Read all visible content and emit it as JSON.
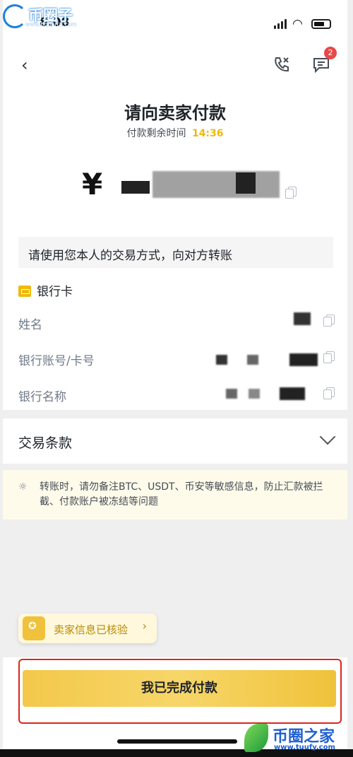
{
  "watermark_top": {
    "brand": "币圈子",
    "url": "www.bquanzi.com"
  },
  "status_bar": {
    "time": "8:08"
  },
  "header": {
    "back_glyph": "‹",
    "chat_badge": "2",
    "title": "请向卖家付款",
    "timer_label": "付款剩余时间",
    "timer_value": "14:36"
  },
  "payment": {
    "currency_symbol": "¥",
    "notice": "请使用您本人的交易方式，向对方转账",
    "method": "银行卡",
    "fields": [
      {
        "label": "姓名"
      },
      {
        "label": "银行账号/卡号"
      },
      {
        "label": "银行名称"
      }
    ]
  },
  "terms": {
    "label": "交易条款"
  },
  "warning": {
    "text": "转账时，请勿备注BTC、USDT、币安等敏感信息，防止汇款被拦截、付款账户被冻结等问题"
  },
  "verified": {
    "label": "卖家信息已核验",
    "arrow": "›"
  },
  "primary_button": {
    "label": "我已完成付款"
  },
  "watermark_bottom": {
    "brand": "币圈之家",
    "url": "www.tuufy.com"
  },
  "colors": {
    "accent": "#f0b90b",
    "badge": "#e84848",
    "outline": "#d9271e"
  }
}
